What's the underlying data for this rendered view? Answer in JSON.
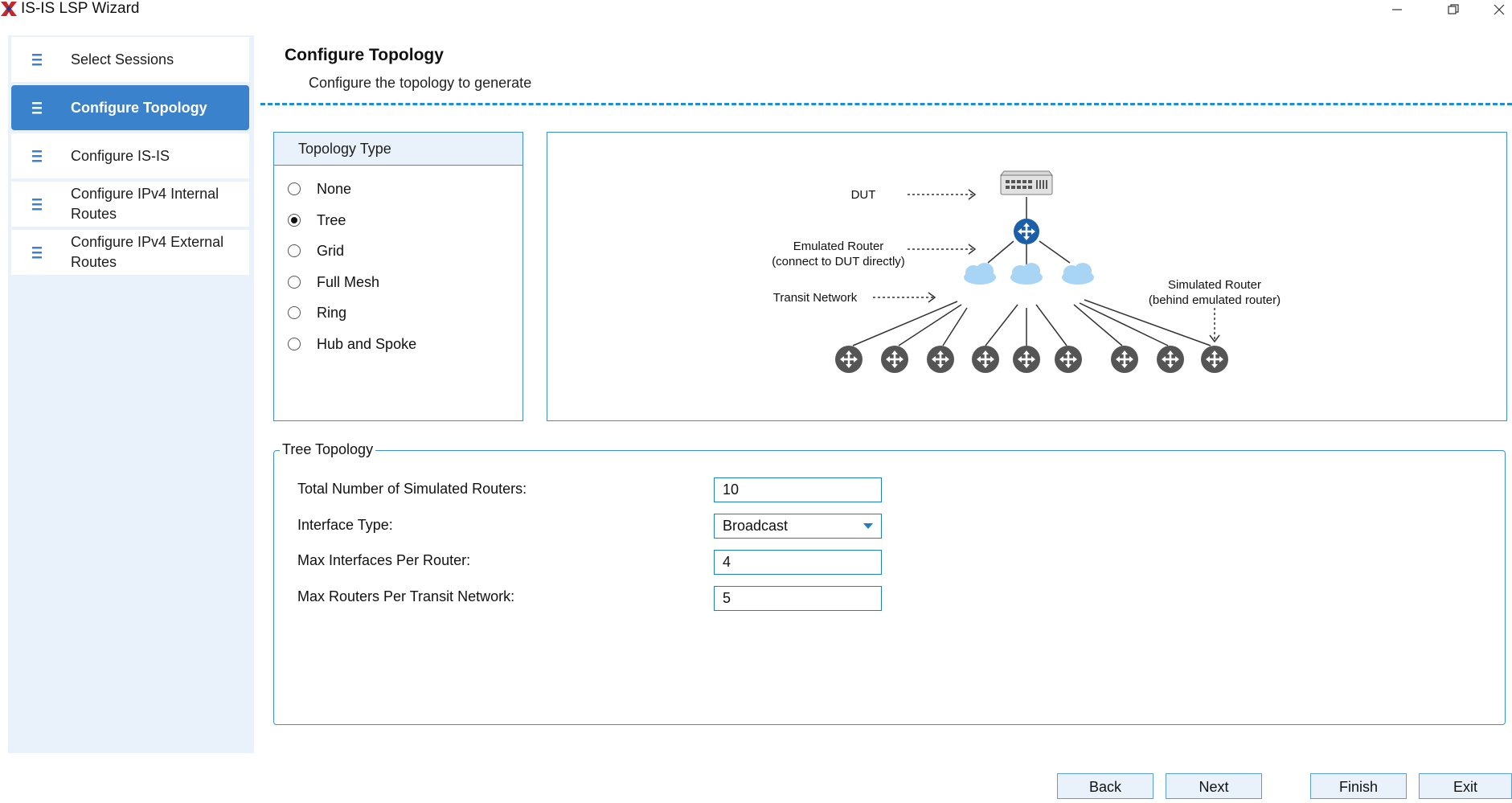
{
  "window": {
    "title": "IS-IS LSP Wizard",
    "controls": [
      "minimize-icon",
      "restore-icon",
      "close-icon"
    ]
  },
  "sidebar": {
    "items": [
      {
        "label": "Select Sessions",
        "active": false,
        "icon": "list-icon"
      },
      {
        "label": "Configure Topology",
        "active": true,
        "icon": "list-icon"
      },
      {
        "label": "Configure IS-IS",
        "active": false,
        "icon": "list-icon"
      },
      {
        "label": "Configure IPv4 Internal Routes",
        "active": false,
        "icon": "list-icon"
      },
      {
        "label": "Configure IPv4 External Routes",
        "active": false,
        "icon": "list-icon"
      }
    ]
  },
  "page": {
    "title": "Configure Topology",
    "subtitle": "Configure the topology to generate"
  },
  "topology_type": {
    "header": "Topology Type",
    "options": [
      {
        "label": "None",
        "selected": false
      },
      {
        "label": "Tree",
        "selected": true
      },
      {
        "label": "Grid",
        "selected": false
      },
      {
        "label": "Full Mesh",
        "selected": false
      },
      {
        "label": "Ring",
        "selected": false
      },
      {
        "label": "Hub and Spoke",
        "selected": false
      }
    ]
  },
  "diagram": {
    "dut_label": "DUT",
    "emulated_router_label": "Emulated Router",
    "emulated_router_note": "(connect to DUT directly)",
    "transit_network_label": "Transit Network",
    "simulated_router_label": "Simulated Router",
    "simulated_router_note": "(behind emulated router)"
  },
  "tree_topology": {
    "legend": "Tree Topology",
    "fields": [
      {
        "label": "Total Number of Simulated Routers:",
        "value": "10",
        "type": "text"
      },
      {
        "label": "Interface Type:",
        "value": "Broadcast",
        "type": "select"
      },
      {
        "label": "Max Interfaces Per Router:",
        "value": "4",
        "type": "text"
      },
      {
        "label": "Max Routers Per Transit Network:",
        "value": "5",
        "type": "text"
      }
    ]
  },
  "footer": {
    "back": "Back",
    "next": "Next",
    "finish": "Finish",
    "exit": "Exit"
  },
  "colors": {
    "accent": "#3b82cc",
    "sidebar_bg": "#e9f2fa",
    "border": "#3d8fd1",
    "router": "#555555",
    "emulated_router": "#1a5fa8",
    "cloud": "#a8d4f5"
  }
}
